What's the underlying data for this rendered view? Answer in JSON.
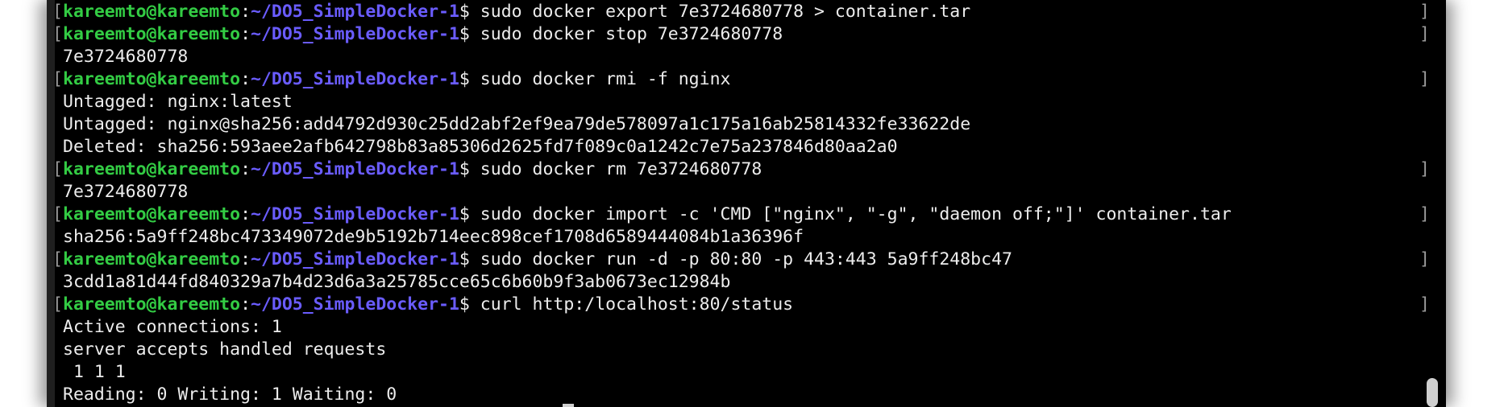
{
  "prompt": {
    "user": "kareemto@kareemto",
    "colon": ":",
    "path": "~/DO5_SimpleDocker-1",
    "dollar": "$"
  },
  "lines": [
    {
      "kind": "prompt",
      "command": " sudo docker export 7e3724680778 > container.tar"
    },
    {
      "kind": "prompt",
      "command": " sudo docker stop 7e3724680778"
    },
    {
      "kind": "output",
      "text": "7e3724680778"
    },
    {
      "kind": "prompt",
      "command": " sudo docker rmi -f nginx"
    },
    {
      "kind": "output",
      "text": "Untagged: nginx:latest"
    },
    {
      "kind": "output",
      "text": "Untagged: nginx@sha256:add4792d930c25dd2abf2ef9ea79de578097a1c175a16ab25814332fe33622de"
    },
    {
      "kind": "output",
      "text": "Deleted: sha256:593aee2afb642798b83a85306d2625fd7f089c0a1242c7e75a237846d80aa2a0"
    },
    {
      "kind": "prompt",
      "command": " sudo docker rm 7e3724680778"
    },
    {
      "kind": "output",
      "text": "7e3724680778"
    },
    {
      "kind": "prompt",
      "command": " sudo docker import -c 'CMD [\"nginx\", \"-g\", \"daemon off;\"]' container.tar"
    },
    {
      "kind": "output",
      "text": "sha256:5a9ff248bc473349072de9b5192b714eec898cef1708d6589444084b1a36396f"
    },
    {
      "kind": "prompt",
      "command": " sudo docker run -d -p 80:80 -p 443:443 5a9ff248bc47"
    },
    {
      "kind": "output",
      "text": "3cdd1a81d44fd840329a7b4d23d6a3a25785cce65c6b60b9f3ab0673ec12984b"
    },
    {
      "kind": "prompt",
      "command": " curl http:/localhost:80/status"
    },
    {
      "kind": "output",
      "text": "Active connections: 1"
    },
    {
      "kind": "output",
      "text": "server accepts handled requests"
    },
    {
      "kind": "output",
      "text": " 1 1 1"
    },
    {
      "kind": "output",
      "text": "Reading: 0 Writing: 1 Waiting: 0"
    }
  ],
  "colors": {
    "background": "#000000",
    "user": "#33cc44",
    "path": "#6a5cff",
    "text": "#ededed",
    "bracket": "#9a9a9a"
  }
}
